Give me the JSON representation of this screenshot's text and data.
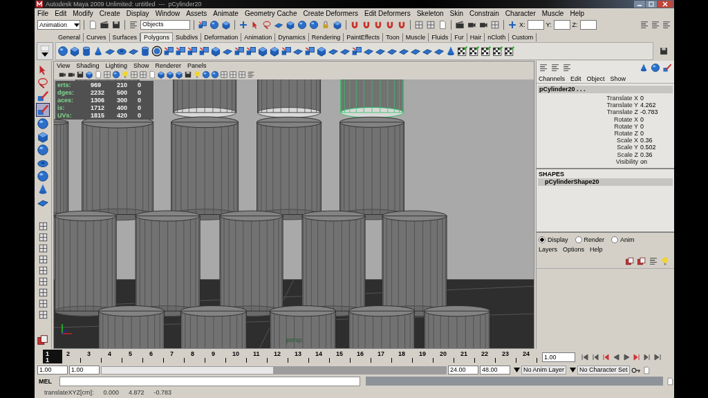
{
  "window": {
    "title": "Autodesk Maya 2009 Unlimited: untitled  ---  pCylinder20"
  },
  "menu": [
    "File",
    "Edit",
    "Modify",
    "Create",
    "Display",
    "Window",
    "Assets",
    "Animate",
    "Geometry Cache",
    "Create Deformers",
    "Edit Deformers",
    "Skeleton",
    "Skin",
    "Constrain",
    "Character",
    "Muscle",
    "Help"
  ],
  "status_line": {
    "menu_set": "Animation",
    "selection_mode": "Objects",
    "x_label": "X:",
    "y_label": "Y:",
    "z_label": "Z:"
  },
  "shelf": {
    "tabs": [
      {
        "label": "General",
        "selected": false
      },
      {
        "label": "Curves",
        "selected": false
      },
      {
        "label": "Surfaces",
        "selected": false
      },
      {
        "label": "Polygons",
        "selected": true
      },
      {
        "label": "Subdivs",
        "selected": false
      },
      {
        "label": "Deformation",
        "selected": false
      },
      {
        "label": "Animation",
        "selected": false
      },
      {
        "label": "Dynamics",
        "selected": false
      },
      {
        "label": "Rendering",
        "selected": false
      },
      {
        "label": "PaintEffects",
        "selected": false
      },
      {
        "label": "Toon",
        "selected": false
      },
      {
        "label": "Muscle",
        "selected": false
      },
      {
        "label": "Fluids",
        "selected": false
      },
      {
        "label": "Fur",
        "selected": false
      },
      {
        "label": "Hair",
        "selected": false
      },
      {
        "label": "nCloth",
        "selected": false
      },
      {
        "label": "Custom",
        "selected": false
      }
    ]
  },
  "panel_menu": [
    "View",
    "Shading",
    "Lighting",
    "Show",
    "Renderer",
    "Panels"
  ],
  "heads_up": [
    {
      "label": "erts:",
      "values": [
        "969",
        "210",
        "0"
      ]
    },
    {
      "label": "dges:",
      "values": [
        "2232",
        "500",
        "0"
      ]
    },
    {
      "label": "aces:",
      "values": [
        "1306",
        "300",
        "0"
      ]
    },
    {
      "label": "is:",
      "values": [
        "1712",
        "400",
        "0"
      ]
    },
    {
      "label": "UVs:",
      "values": [
        "1815",
        "420",
        "0"
      ]
    }
  ],
  "camera_label": "persp",
  "channel_box": {
    "menu": [
      "Channels",
      "Edit",
      "Object",
      "Show"
    ],
    "object": "pCylinder20 . . .",
    "attributes": [
      {
        "name": "Translate X",
        "value": "0"
      },
      {
        "name": "Translate Y",
        "value": "4.262"
      },
      {
        "name": "Translate Z",
        "value": "-0.783"
      },
      {
        "name": "Rotate X",
        "value": "0"
      },
      {
        "name": "Rotate Y",
        "value": "0"
      },
      {
        "name": "Rotate Z",
        "value": "0"
      },
      {
        "name": "Scale X",
        "value": "0.36"
      },
      {
        "name": "Scale Y",
        "value": "0.502"
      },
      {
        "name": "Scale Z",
        "value": "0.36"
      },
      {
        "name": "Visibility",
        "value": "on"
      }
    ],
    "shapes_heading": "SHAPES",
    "shape": "pCylinderShape20"
  },
  "layer_editor": {
    "modes": [
      {
        "label": "Display",
        "selected": true
      },
      {
        "label": "Render",
        "selected": false
      },
      {
        "label": "Anim",
        "selected": false
      }
    ],
    "menu": [
      "Layers",
      "Options",
      "Help"
    ]
  },
  "timeline": {
    "current_frame": "1",
    "frames": [
      {
        "label": "1",
        "selected": true
      },
      {
        "label": "2",
        "selected": false
      },
      {
        "label": "3",
        "selected": false
      },
      {
        "label": "4",
        "selected": false
      },
      {
        "label": "5",
        "selected": false
      },
      {
        "label": "6",
        "selected": false
      },
      {
        "label": "7",
        "selected": false
      },
      {
        "label": "8",
        "selected": false
      },
      {
        "label": "9",
        "selected": false
      },
      {
        "label": "10",
        "selected": false
      },
      {
        "label": "11",
        "selected": false
      },
      {
        "label": "12",
        "selected": false
      },
      {
        "label": "13",
        "selected": false
      },
      {
        "label": "14",
        "selected": false
      },
      {
        "label": "15",
        "selected": false
      },
      {
        "label": "16",
        "selected": false
      },
      {
        "label": "17",
        "selected": false
      },
      {
        "label": "18",
        "selected": false
      },
      {
        "label": "19",
        "selected": false
      },
      {
        "label": "20",
        "selected": false
      },
      {
        "label": "21",
        "selected": false
      },
      {
        "label": "22",
        "selected": false
      },
      {
        "label": "23",
        "selected": false
      },
      {
        "label": "24",
        "selected": false
      }
    ],
    "current_time": "1.00"
  },
  "range_slider": {
    "level": 0.5
  },
  "range": {
    "start": "1.00",
    "playback_start": "1.00",
    "playback_end": "24.00",
    "end": "48.00",
    "anim_layer": "No Anim Layer",
    "character_set": "No Character Set"
  },
  "command_line": {
    "label": "MEL"
  },
  "help_line": {
    "label": "translateXYZ[cm]:",
    "values": [
      "0.000",
      "4.872",
      "-0.783"
    ]
  }
}
